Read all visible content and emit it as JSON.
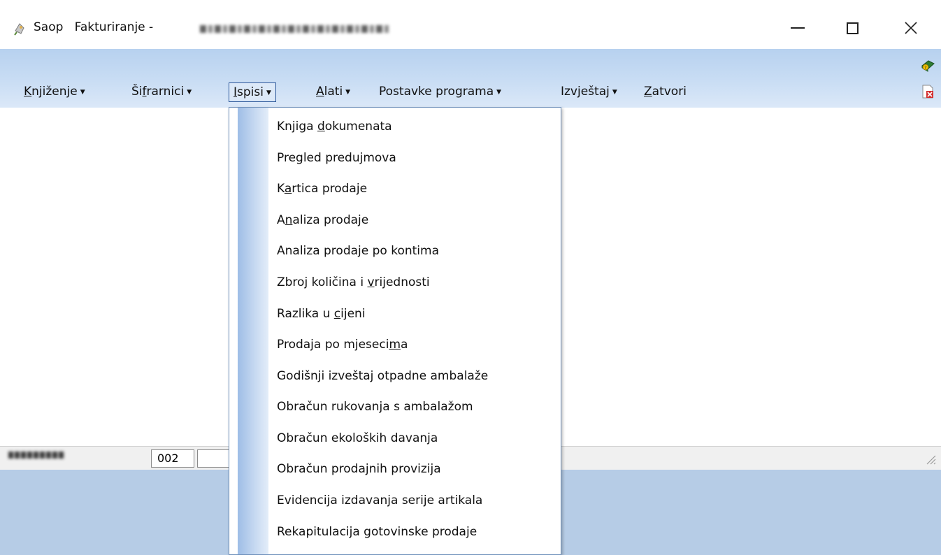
{
  "window": {
    "app_name": "Saop",
    "title": "Fakturiranje -",
    "company_name": "TESTNO PODUZEĆE D.O.O."
  },
  "menubar": {
    "items": [
      {
        "pre": "",
        "accel": "K",
        "post": "njiženje",
        "arrow": "▼"
      },
      {
        "pre": "Ši",
        "accel": "f",
        "post": "rarnici",
        "arrow": "▼"
      },
      {
        "pre": "",
        "accel": "I",
        "post": "spisi",
        "arrow": "▼"
      },
      {
        "pre": "",
        "accel": "A",
        "post": "lati",
        "arrow": "▼"
      },
      {
        "pre": "Postavke programa",
        "accel": "",
        "post": "",
        "arrow": "▼"
      },
      {
        "pre": "Izvještaj",
        "accel": "",
        "post": "",
        "arrow": "▼"
      },
      {
        "pre": "",
        "accel": "Z",
        "post": "atvori",
        "arrow": ""
      }
    ]
  },
  "dropdown": {
    "items": [
      {
        "pre": "Knjiga ",
        "accel": "d",
        "post": "okumenata"
      },
      {
        "pre": "Pregled predujmova",
        "accel": "",
        "post": ""
      },
      {
        "pre": "K",
        "accel": "a",
        "post": "rtica prodaje"
      },
      {
        "pre": "A",
        "accel": "n",
        "post": "aliza prodaje"
      },
      {
        "pre": "Analiza prodaje po kontima",
        "accel": "",
        "post": ""
      },
      {
        "pre": "Zbroj količina i ",
        "accel": "v",
        "post": "rijednosti"
      },
      {
        "pre": "Razlika u ",
        "accel": "c",
        "post": "ijeni"
      },
      {
        "pre": "Prodaja po mjeseci",
        "accel": "m",
        "post": "a"
      },
      {
        "pre": "Godišnji izveštaj otpadne ambalaže",
        "accel": "",
        "post": ""
      },
      {
        "pre": "Obračun rukovanja s ambalažom",
        "accel": "",
        "post": ""
      },
      {
        "pre": "Obračun ekoloških davanja",
        "accel": "",
        "post": ""
      },
      {
        "pre": "Obračun prodajnih provizija",
        "accel": "",
        "post": ""
      },
      {
        "pre": "Evidencija izdavanja serije artikala",
        "accel": "",
        "post": ""
      },
      {
        "pre": "Rekapitulacija gotovinske prodaje",
        "accel": "",
        "post": ""
      }
    ]
  },
  "statusbar": {
    "user": "Uređivač",
    "code": "002",
    "field2": ""
  },
  "icons": {
    "app": "saop-app-icon",
    "help": "help-book-icon",
    "exit": "exit-document-icon",
    "grip": "resize-grip-icon"
  }
}
